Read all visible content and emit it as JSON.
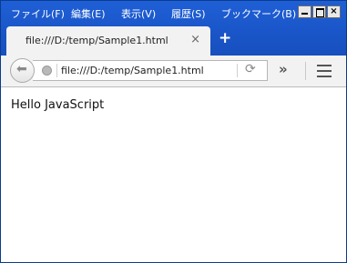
{
  "menu": [
    "ファイル(F)",
    "編集(E)",
    "表示(V)",
    "履歴(S)",
    "ブックマーク(B)"
  ],
  "window_controls": {
    "minimize": "minimize",
    "maximize": "maximize",
    "close": "×"
  },
  "tab": {
    "title": "file:///D:/temp/Sample1.html",
    "close": "×"
  },
  "new_tab": "+",
  "toolbar": {
    "back_icon": "back-arrow-icon",
    "url": "file:///D:/temp/Sample1.html",
    "reload_icon": "reload-icon",
    "overflow": "»",
    "menu_icon": "hamburger-icon"
  },
  "page": {
    "body_text": "Hello JavaScript"
  },
  "colors": {
    "titlebar": "#1a56c9",
    "tab": "#f2f2f2",
    "toolbar": "#f2f2f2"
  }
}
